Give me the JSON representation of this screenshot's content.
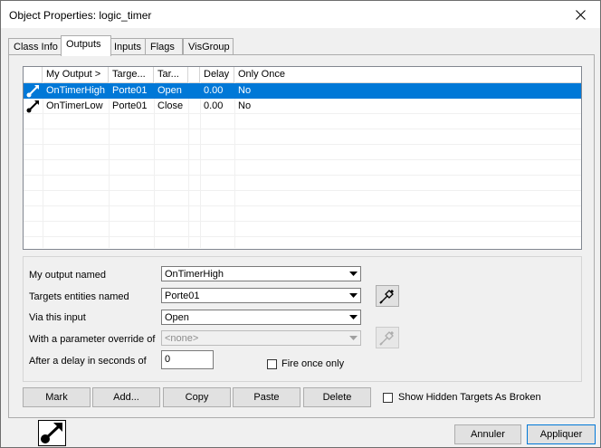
{
  "window": {
    "title": "Object Properties: logic_timer"
  },
  "tabs": [
    {
      "label": "Class Info"
    },
    {
      "label": "Outputs"
    },
    {
      "label": "Inputs"
    },
    {
      "label": "Flags"
    },
    {
      "label": "VisGroup"
    }
  ],
  "outputs_list": {
    "columns": [
      "My Output  >",
      "Targe...",
      "Tar...",
      "",
      "Delay",
      "Only Once"
    ],
    "rows": [
      {
        "output": "OnTimerHigh",
        "target": "Porte01",
        "input": "Open",
        "param": "",
        "delay": "0.00",
        "once": "No"
      },
      {
        "output": "OnTimerLow",
        "target": "Porte01",
        "input": "Close",
        "param": "",
        "delay": "0.00",
        "once": "No"
      }
    ],
    "selected_index": 0
  },
  "form": {
    "output_label": "My output named",
    "output_value": "OnTimerHigh",
    "targets_label": "Targets entities named",
    "targets_value": "Porte01",
    "input_label": "Via this input",
    "input_value": "Open",
    "param_label": "With a parameter override of",
    "param_value": "<none>",
    "delay_label": "After a delay in seconds of",
    "delay_value": "0",
    "fire_once_label": "Fire once only",
    "fire_once_checked": false
  },
  "actions": {
    "mark": "Mark",
    "add": "Add...",
    "copy": "Copy",
    "paste": "Paste",
    "delete": "Delete",
    "show_hidden_label": "Show Hidden Targets As Broken",
    "show_hidden_checked": false
  },
  "footer": {
    "cancel": "Annuler",
    "apply": "Appliquer"
  },
  "colors": {
    "selection": "#0078d7",
    "window_bg": "#f0f0f0"
  },
  "icons": {
    "row_icon": "output-connection-icon",
    "picker": "eyedropper-icon",
    "close": "close-icon"
  }
}
